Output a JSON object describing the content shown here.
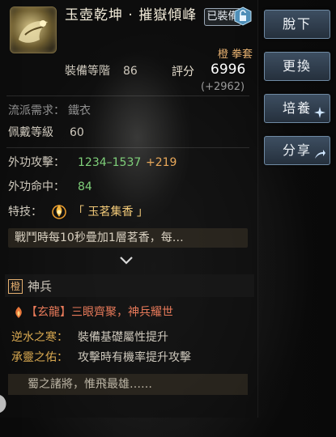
{
  "item": {
    "name": "玉壺乾坤 · 摧嶽傾峰",
    "equipped_badge": "已裝備",
    "quality_tag": "橙 拳套",
    "equip_level_label": "裝備等階",
    "equip_level_value": "86",
    "score_label": "評分",
    "score_value": "6996",
    "score_delta": "(+2962)"
  },
  "requirements": {
    "school_label": "流派需求：",
    "school_value": "鐵衣",
    "wear_level_label": "佩戴等級",
    "wear_level_value": "60"
  },
  "stats": {
    "attack_label": "外功攻擊：",
    "attack_value": "1234–1537",
    "attack_bonus": "+219",
    "hit_label": "外功命中：",
    "hit_value": "84"
  },
  "skill": {
    "label": "特技：",
    "name": "「 玉茗集香 」",
    "description": "戰鬥時每10秒疊加1層茗香，每…"
  },
  "divine_weapon": {
    "quality": "橙",
    "title": "神兵",
    "dragon_effect": "【玄龍】三眼齊聚，神兵耀世",
    "effect1_label": "逆水之寒：",
    "effect1_text": "裝備基礎屬性提升",
    "effect2_label": "承靈之佑：",
    "effect2_text": "攻擊時有機率提升攻擊",
    "flavor": "蜀之諸將，惟飛最雄……"
  },
  "buttons": {
    "unequip": "脫下",
    "replace": "更換",
    "cultivate": "培養",
    "share": "分享"
  },
  "icons": {
    "lock": "lock-icon",
    "skill": "flame-skill-icon",
    "expand": "chevron-down-icon",
    "flame": "flame-icon",
    "cultivate": "sparkle-icon",
    "share": "share-icon"
  },
  "colors": {
    "quality_orange": "#e6b070",
    "stat_green": "#7fd07a",
    "button_blue": "#46607a"
  }
}
